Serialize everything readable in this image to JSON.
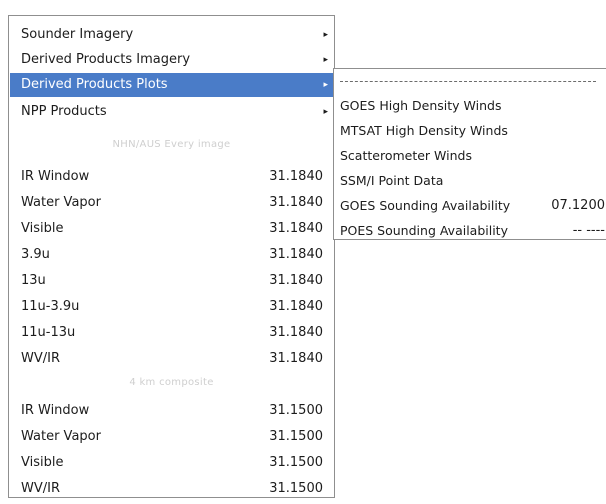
{
  "main_menu": {
    "items": [
      {
        "label": "Sounder Imagery",
        "arrow": "▸"
      },
      {
        "label": "Derived Products Imagery",
        "arrow": "▸"
      },
      {
        "label": "Derived Products Plots",
        "arrow": "▸"
      },
      {
        "label": "NPP Products",
        "arrow": "▸"
      }
    ],
    "group1": {
      "header": "NHN/AUS Every image",
      "items": [
        {
          "label": "IR Window",
          "value": "31.1840"
        },
        {
          "label": "Water Vapor",
          "value": "31.1840"
        },
        {
          "label": "Visible",
          "value": "31.1840"
        },
        {
          "label": "3.9u",
          "value": "31.1840"
        },
        {
          "label": "13u",
          "value": "31.1840"
        },
        {
          "label": "11u-3.9u",
          "value": "31.1840"
        },
        {
          "label": "11u-13u",
          "value": "31.1840"
        },
        {
          "label": "WV/IR",
          "value": "31.1840"
        }
      ]
    },
    "group2": {
      "header": "4 km composite",
      "items": [
        {
          "label": "IR Window",
          "value": "31.1500"
        },
        {
          "label": "Water Vapor",
          "value": "31.1500"
        },
        {
          "label": "Visible",
          "value": "31.1500"
        },
        {
          "label": "WV/IR",
          "value": "31.1500"
        }
      ]
    }
  },
  "sub_menu": {
    "items": [
      {
        "label": "GOES High Density Winds",
        "value": ""
      },
      {
        "label": "MTSAT High Density Winds",
        "value": ""
      },
      {
        "label": "Scatterometer Winds",
        "value": ""
      },
      {
        "label": "SSM/I Point Data",
        "value": ""
      },
      {
        "label": "GOES Sounding Availability",
        "value": "07.1200"
      },
      {
        "label": "POES Sounding Availability",
        "value": "-- ----"
      }
    ]
  },
  "colors": {
    "selected_bg": "#4a7cc8",
    "border": "#8f8f8f"
  }
}
